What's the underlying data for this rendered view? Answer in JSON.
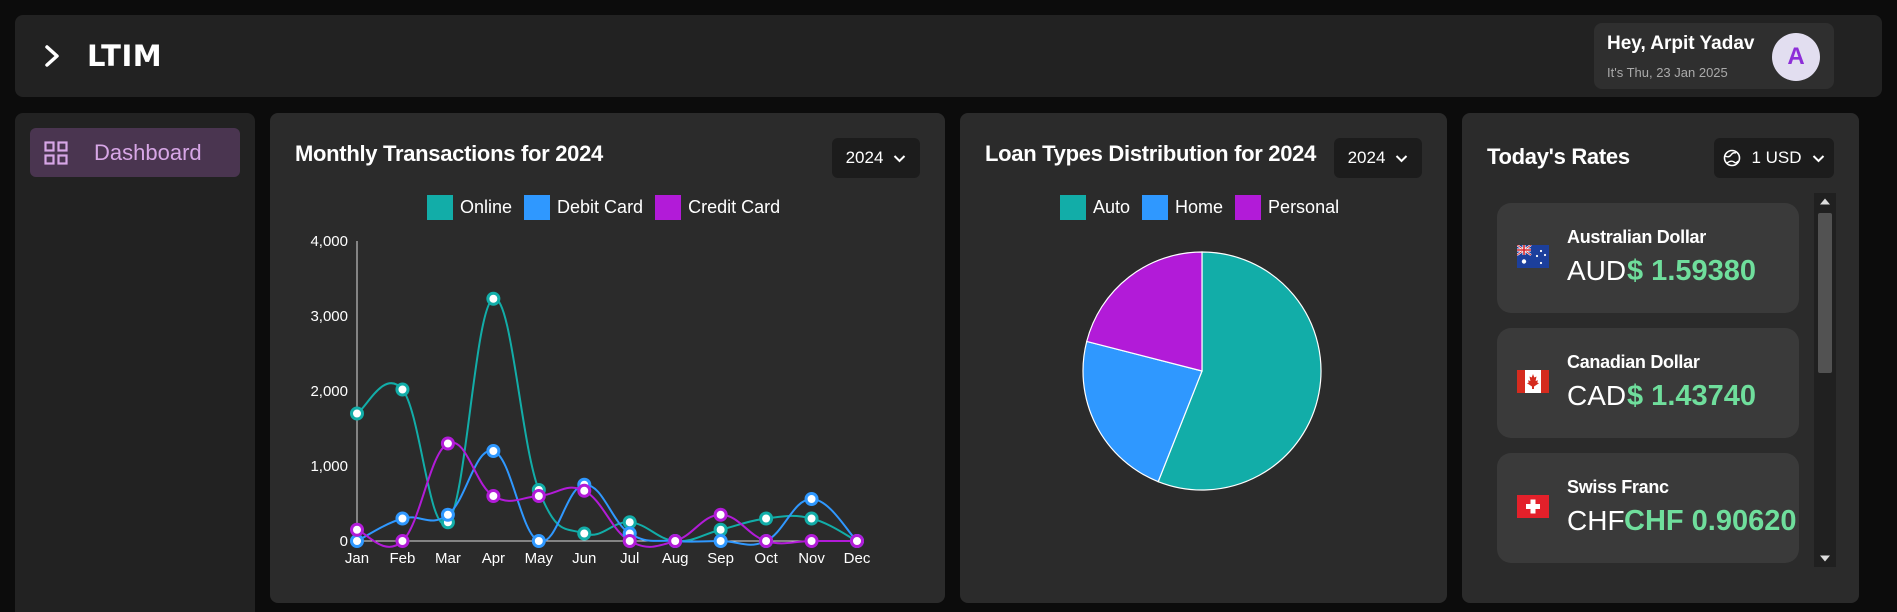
{
  "header": {
    "brand": "LTIM",
    "greeting": "Hey, Arpit Yadav",
    "date": "It's Thu, 23 Jan 2025",
    "avatar_letter": "A"
  },
  "sidebar": {
    "items": [
      {
        "label": "Dashboard",
        "icon": "dashboard-grid-icon",
        "active": true
      }
    ]
  },
  "colors": {
    "online": "#12ada8",
    "debit": "#2f98ff",
    "credit": "#b21bd8",
    "accent": "#d7a6e6",
    "rate_value": "#6fde9c"
  },
  "transactions": {
    "title": "Monthly Transactions for 2024",
    "year": "2024",
    "legend": [
      "Online",
      "Debit Card",
      "Credit Card"
    ]
  },
  "loans": {
    "title": "Loan Types Distribution for 2024",
    "year": "2024",
    "legend": [
      "Auto",
      "Home",
      "Personal"
    ]
  },
  "rates": {
    "title": "Today's Rates",
    "base": "1 USD",
    "base_icon": "globe-icon",
    "items": [
      {
        "name": "Australian Dollar",
        "code": "AUD",
        "value": "$ 1.59380",
        "flag": "australia-flag-icon"
      },
      {
        "name": "Canadian Dollar",
        "code": "CAD",
        "value": "$ 1.43740",
        "flag": "canada-flag-icon"
      },
      {
        "name": "Swiss Franc",
        "code": "CHF",
        "value": "CHF 0.90620",
        "flag": "switzerland-flag-icon"
      }
    ]
  },
  "chart_data": [
    {
      "type": "line",
      "categories": [
        "Jan",
        "Feb",
        "Mar",
        "Apr",
        "May",
        "Jun",
        "Jul",
        "Aug",
        "Sep",
        "Oct",
        "Nov",
        "Dec"
      ],
      "yticks": [
        "0",
        "1,000",
        "2,000",
        "3,000",
        "4,000"
      ],
      "ylim": [
        0,
        4000
      ],
      "grid": false,
      "legend_position": "top",
      "series": [
        {
          "name": "Online",
          "values": [
            1700,
            2020,
            250,
            3230,
            680,
            100,
            250,
            0,
            150,
            300,
            300,
            0
          ]
        },
        {
          "name": "Debit Card",
          "values": [
            0,
            300,
            350,
            1200,
            0,
            750,
            100,
            0,
            0,
            0,
            560,
            0
          ]
        },
        {
          "name": "Credit Card",
          "values": [
            150,
            0,
            1300,
            600,
            600,
            670,
            0,
            0,
            350,
            0,
            0,
            0
          ]
        }
      ]
    },
    {
      "type": "pie",
      "legend_position": "top",
      "categories": [
        "Auto",
        "Home",
        "Personal"
      ],
      "values": [
        56,
        23,
        21
      ]
    }
  ]
}
